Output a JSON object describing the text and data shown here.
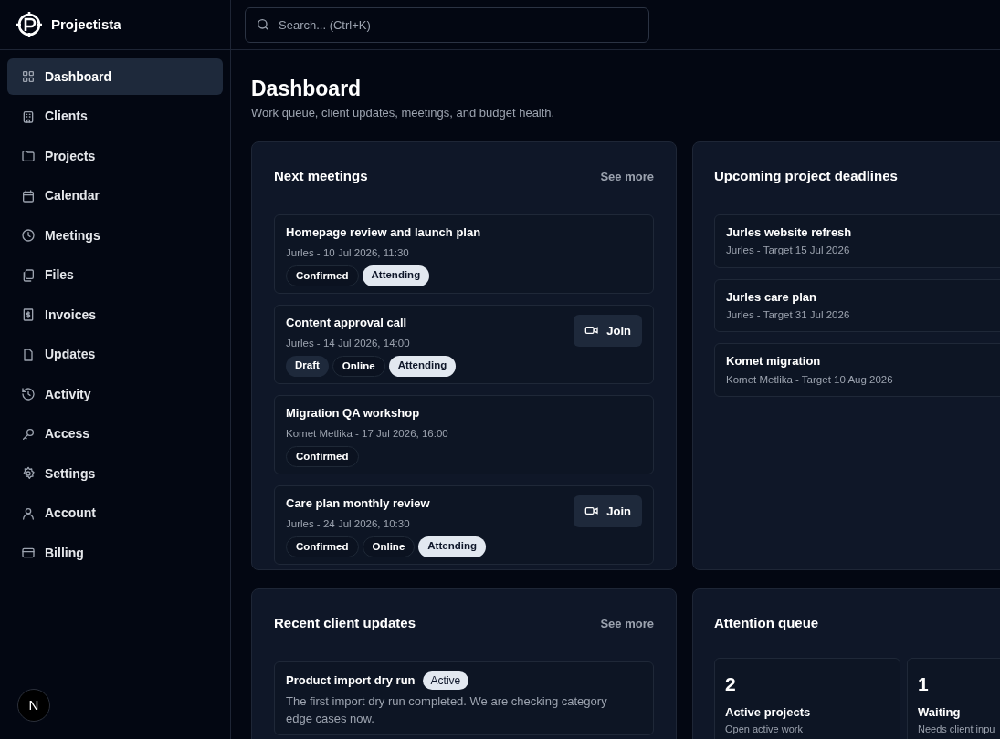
{
  "app": {
    "name": "Projectista"
  },
  "search": {
    "placeholder": "Search... (Ctrl+K)"
  },
  "sidebar": {
    "items": [
      {
        "label": "Dashboard",
        "selected": true
      },
      {
        "label": "Clients",
        "selected": false
      },
      {
        "label": "Projects",
        "selected": false
      },
      {
        "label": "Calendar",
        "selected": false
      },
      {
        "label": "Meetings",
        "selected": false
      },
      {
        "label": "Files",
        "selected": false
      },
      {
        "label": "Invoices",
        "selected": false
      },
      {
        "label": "Updates",
        "selected": false
      },
      {
        "label": "Activity",
        "selected": false
      },
      {
        "label": "Access",
        "selected": false
      },
      {
        "label": "Settings",
        "selected": false
      },
      {
        "label": "Account",
        "selected": false
      },
      {
        "label": "Billing",
        "selected": false
      }
    ],
    "avatar": "N"
  },
  "page": {
    "title": "Dashboard",
    "subtitle": "Work queue, client updates, meetings, and budget health."
  },
  "next_meetings": {
    "title": "Next meetings",
    "link": "See more",
    "items": [
      {
        "title": "Homepage review and launch plan",
        "meta": "Jurles - 10 Jul 2026, 11:30",
        "tags": [
          {
            "label": "Confirmed",
            "kind": "outline"
          },
          {
            "label": "Attending",
            "kind": "light"
          }
        ]
      },
      {
        "title": "Content approval call",
        "meta": "Jurles - 14 Jul 2026, 14:00",
        "join": "Join",
        "tags": [
          {
            "label": "Draft",
            "kind": "muted"
          },
          {
            "label": "Online",
            "kind": "outline"
          },
          {
            "label": "Attending",
            "kind": "light"
          }
        ]
      },
      {
        "title": "Migration QA workshop",
        "meta": "Komet Metlika - 17 Jul 2026, 16:00",
        "tags": [
          {
            "label": "Confirmed",
            "kind": "outline"
          }
        ]
      },
      {
        "title": "Care plan monthly review",
        "meta": "Jurles - 24 Jul 2026, 10:30",
        "join": "Join",
        "tags": [
          {
            "label": "Confirmed",
            "kind": "outline"
          },
          {
            "label": "Online",
            "kind": "outline"
          },
          {
            "label": "Attending",
            "kind": "light"
          }
        ]
      }
    ]
  },
  "deadlines": {
    "title": "Upcoming project deadlines",
    "items": [
      {
        "title": "Jurles website refresh",
        "meta": "Jurles - Target 15 Jul 2026"
      },
      {
        "title": "Jurles care plan",
        "meta": "Jurles - Target 31 Jul 2026"
      },
      {
        "title": "Komet migration",
        "meta": "Komet Metlika - Target 10 Aug 2026"
      }
    ]
  },
  "client_updates": {
    "title": "Recent client updates",
    "link": "See more",
    "items": [
      {
        "title": "Product import dry run",
        "status": "Active",
        "body": "The first import dry run completed. We are checking category edge cases now."
      }
    ]
  },
  "attention_queue": {
    "title": "Attention queue",
    "items": [
      {
        "count": "2",
        "label": "Active projects",
        "hint": "Open active work"
      },
      {
        "count": "1",
        "label": "Waiting",
        "hint": "Needs client inpu"
      }
    ]
  }
}
